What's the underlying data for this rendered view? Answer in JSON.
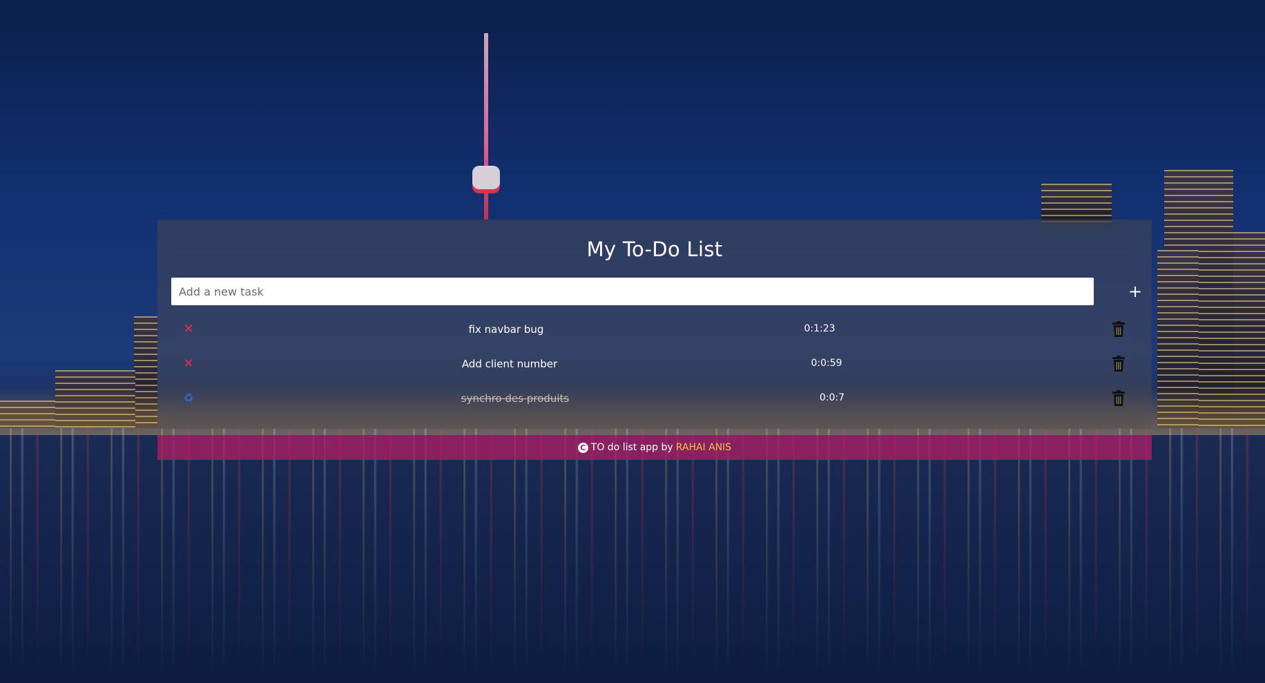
{
  "app": {
    "title": "My To-Do List"
  },
  "input": {
    "placeholder": "Add a new task",
    "value": ""
  },
  "add_button": {
    "label": "+"
  },
  "tasks": [
    {
      "name": "fix navbar bug",
      "time": "0:1:23",
      "status_icon": "close-icon",
      "completed": false
    },
    {
      "name": "Add client number",
      "time": "0:0:59",
      "status_icon": "close-icon",
      "completed": false
    },
    {
      "name": "synchro des produits",
      "time": "0:0:7",
      "status_icon": "recycle-icon",
      "completed": true
    }
  ],
  "footer": {
    "icon": "copyright-icon",
    "text": "TO do list app by",
    "author": "RAHAI ANIS"
  },
  "colors": {
    "footer_bg": "#aa1e64",
    "author": "#f0c040",
    "status_x": "#e8304a",
    "status_recycle": "#2a6fd6"
  }
}
